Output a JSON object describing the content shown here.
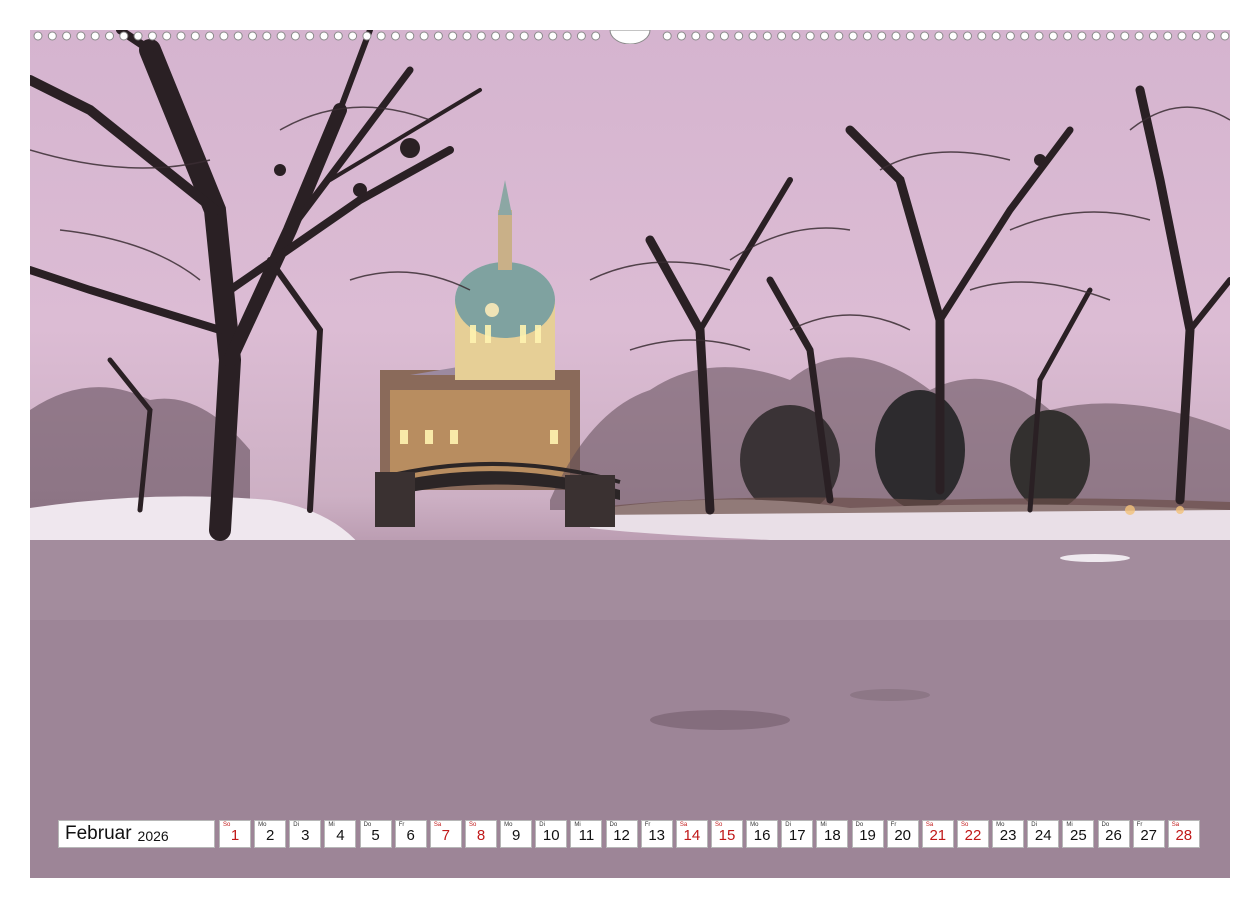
{
  "calendar": {
    "month": "Februar",
    "year": "2026",
    "weekend_color": "#c01818",
    "days": [
      {
        "wd": "So",
        "num": "1",
        "weekend": true
      },
      {
        "wd": "Mo",
        "num": "2",
        "weekend": false
      },
      {
        "wd": "Di",
        "num": "3",
        "weekend": false
      },
      {
        "wd": "Mi",
        "num": "4",
        "weekend": false
      },
      {
        "wd": "Do",
        "num": "5",
        "weekend": false
      },
      {
        "wd": "Fr",
        "num": "6",
        "weekend": false
      },
      {
        "wd": "Sa",
        "num": "7",
        "weekend": true
      },
      {
        "wd": "So",
        "num": "8",
        "weekend": true
      },
      {
        "wd": "Mo",
        "num": "9",
        "weekend": false
      },
      {
        "wd": "Di",
        "num": "10",
        "weekend": false
      },
      {
        "wd": "Mi",
        "num": "11",
        "weekend": false
      },
      {
        "wd": "Do",
        "num": "12",
        "weekend": false
      },
      {
        "wd": "Fr",
        "num": "13",
        "weekend": false
      },
      {
        "wd": "Sa",
        "num": "14",
        "weekend": true
      },
      {
        "wd": "So",
        "num": "15",
        "weekend": true
      },
      {
        "wd": "Mo",
        "num": "16",
        "weekend": false
      },
      {
        "wd": "Di",
        "num": "17",
        "weekend": false
      },
      {
        "wd": "Mi",
        "num": "18",
        "weekend": false
      },
      {
        "wd": "Do",
        "num": "19",
        "weekend": false
      },
      {
        "wd": "Fr",
        "num": "20",
        "weekend": false
      },
      {
        "wd": "Sa",
        "num": "21",
        "weekend": true
      },
      {
        "wd": "So",
        "num": "22",
        "weekend": true
      },
      {
        "wd": "Mo",
        "num": "23",
        "weekend": false
      },
      {
        "wd": "Di",
        "num": "24",
        "weekend": false
      },
      {
        "wd": "Mi",
        "num": "25",
        "weekend": false
      },
      {
        "wd": "Do",
        "num": "26",
        "weekend": false
      },
      {
        "wd": "Fr",
        "num": "27",
        "weekend": false
      },
      {
        "wd": "Sa",
        "num": "28",
        "weekend": true
      }
    ]
  }
}
